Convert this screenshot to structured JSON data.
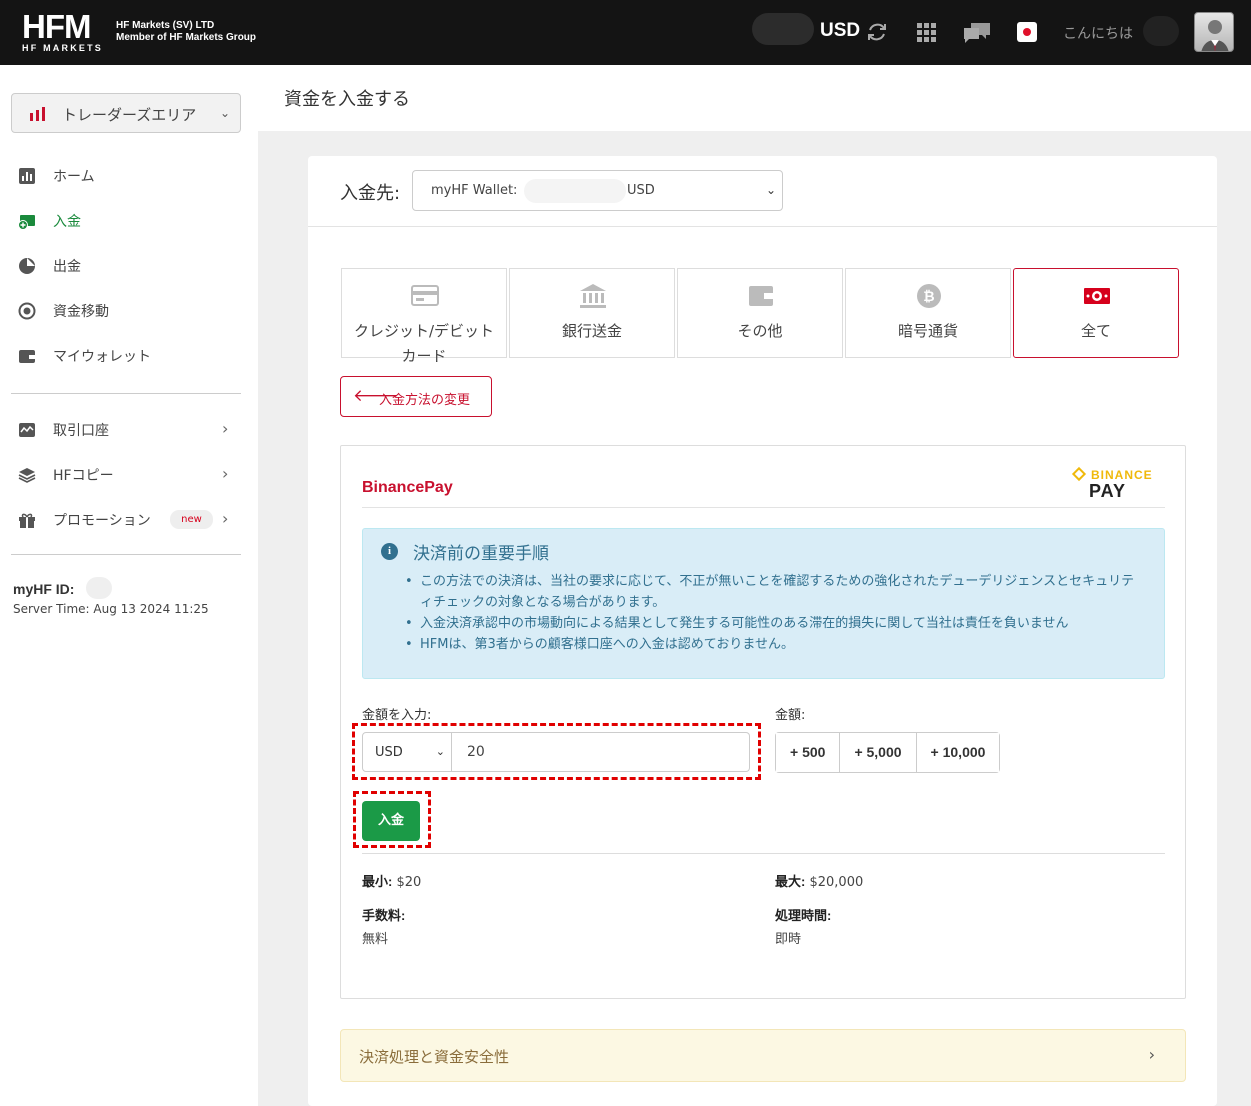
{
  "topbar": {
    "logo_main": "HFM",
    "logo_sub": "HF MARKETS",
    "company_line1": "HF Markets (SV) LTD",
    "company_line2": "Member of HF Markets Group",
    "currency": "USD",
    "greeting": "こんにちは",
    "icons": [
      "refresh-icon",
      "apps-grid-icon",
      "chat-icon",
      "language-flag-icon",
      "user-avatar"
    ]
  },
  "sidebar": {
    "area_selector": "トレーダーズエリア",
    "items": [
      {
        "label": "ホーム",
        "icon": "home-chart-icon",
        "active": false
      },
      {
        "label": "入金",
        "icon": "deposit-icon",
        "active": true
      },
      {
        "label": "出金",
        "icon": "withdraw-icon",
        "active": false
      },
      {
        "label": "資金移動",
        "icon": "transfer-icon",
        "active": false
      },
      {
        "label": "マイウォレット",
        "icon": "wallet-icon",
        "active": false
      }
    ],
    "sub_items": [
      {
        "label": "取引口座",
        "icon": "trading-account-icon"
      },
      {
        "label": "HFコピー",
        "icon": "copy-layers-icon"
      },
      {
        "label": "プロモーション",
        "icon": "gift-icon",
        "badge": "new"
      }
    ],
    "myhf_id_label": "myHF ID:",
    "server_time": "Server Time: Aug 13 2024 11:25"
  },
  "page": {
    "title": "資金を入金する",
    "destination_label": "入金先:",
    "destination_value": "myHF Wallet:",
    "destination_suffix": "USD",
    "methods": [
      {
        "label": "クレジット/デビットカード",
        "icon": "credit-card-icon",
        "selected": false
      },
      {
        "label": "銀行送金",
        "icon": "bank-icon",
        "selected": false
      },
      {
        "label": "その他",
        "icon": "wallet-other-icon",
        "selected": false
      },
      {
        "label": "暗号通貨",
        "icon": "bitcoin-icon",
        "selected": false
      },
      {
        "label": "全て",
        "icon": "money-all-icon",
        "selected": true
      }
    ],
    "change_method": "入金方法の変更",
    "provider": "BinancePay",
    "provider_logo_top": "BINANCE",
    "provider_logo_bottom": "PAY",
    "notice": {
      "title": "決済前の重要手順",
      "items": [
        "この方法での決済は、当社の要求に応じて、不正が無いことを確認するための強化されたデューデリジェンスとセキュリティチェックの対象となる場合があります。",
        "入金決済承認中の市場動向による結果として発生する可能性のある滞在的損失に関して当社は責任を負いません",
        "HFMは、第3者からの顧客様口座への入金は認めておりません。"
      ]
    },
    "amount_input_label": "金額を入力:",
    "amount_currency": "USD",
    "amount_value": "20",
    "quick_label": "金額:",
    "quick_amounts": [
      "+ 500",
      "+ 5,000",
      "+ 10,000"
    ],
    "deposit_button": "入金",
    "min_label": "最小:",
    "min_value": "$20",
    "max_label": "最大:",
    "max_value": "$20,000",
    "fee_label": "手数料:",
    "fee_value": "無料",
    "time_label": "処理時間:",
    "time_value": "即時",
    "safety": "決済処理と資金安全性"
  },
  "colors": {
    "brand_red": "#c8102e",
    "active_green": "#1a8a3c",
    "deposit_green": "#1b9a47",
    "info_bg": "#d9edf7",
    "info_text": "#31708f",
    "warning_bg": "#fcf8e3"
  }
}
